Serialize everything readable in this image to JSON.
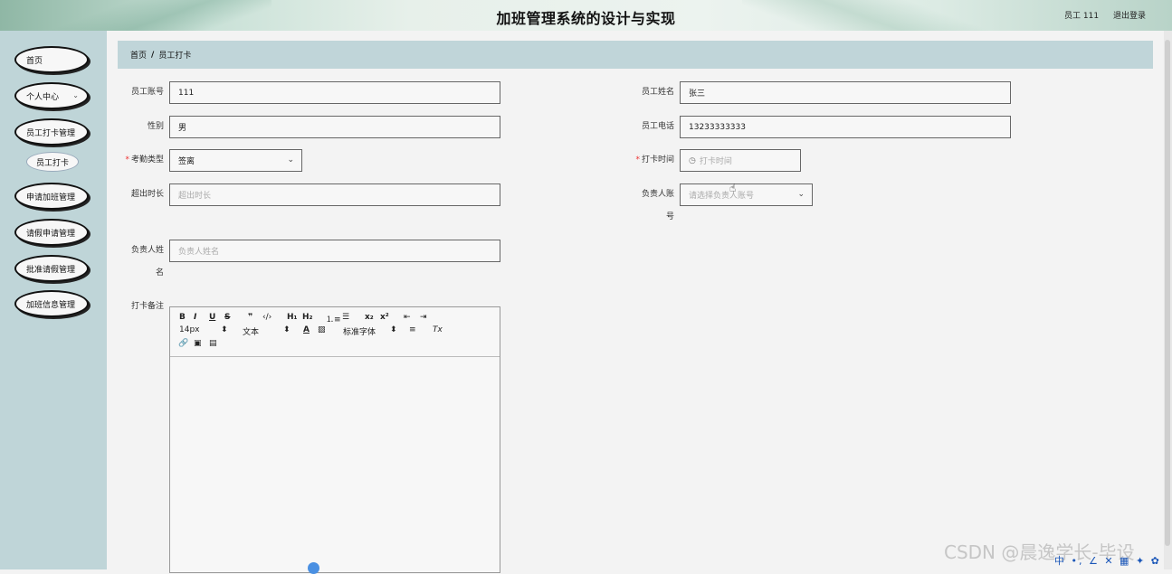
{
  "header": {
    "title": "加班管理系统的设计与实现",
    "user": "员工 111",
    "logout": "退出登录"
  },
  "sidebar": {
    "items": [
      {
        "label": "首页"
      },
      {
        "label": "个人中心",
        "arrow": "⌄"
      },
      {
        "label": "员工打卡管理"
      },
      {
        "label": "员工打卡",
        "sub": true
      },
      {
        "label": "申请加班管理"
      },
      {
        "label": "请假申请管理"
      },
      {
        "label": "批准请假管理"
      },
      {
        "label": "加班信息管理"
      }
    ]
  },
  "breadcrumb": {
    "home": "首页",
    "sep": "/",
    "current": "员工打卡"
  },
  "form": {
    "account_label": "员工账号",
    "account_value": "111",
    "name_label": "员工姓名",
    "name_value": "张三",
    "gender_label": "性别",
    "gender_value": "男",
    "phone_label": "员工电话",
    "phone_value": "13233333333",
    "type_label": "考勤类型",
    "type_value": "签离",
    "time_label": "打卡时间",
    "time_placeholder": "打卡时间",
    "overtime_label": "超出时长",
    "overtime_placeholder": "超出时长",
    "manager_account_label_1": "负责人账",
    "manager_account_label_2": "号",
    "manager_account_placeholder": "请选择负责人账号",
    "manager_name_label_1": "负责人姓",
    "manager_name_label_2": "名",
    "manager_name_placeholder": "负责人姓名",
    "remark_label": "打卡备注",
    "required_mark": "*"
  },
  "editor": {
    "font_size": "14px",
    "text_style": "文本",
    "font_family": "标准字体"
  },
  "watermark": "CSDN @晨逸学长-毕设",
  "tray": "中 •, ∠ ✕ ▦ ✦ ✿"
}
